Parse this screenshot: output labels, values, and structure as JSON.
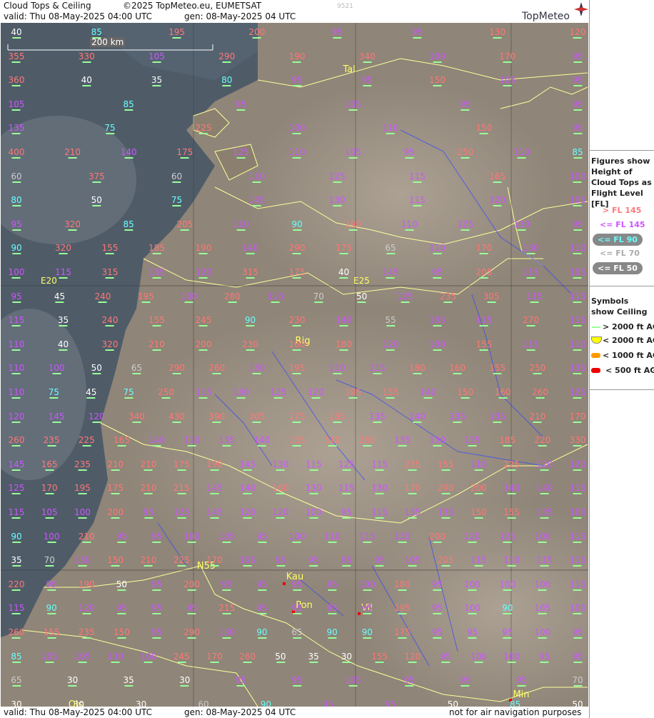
{
  "header": {
    "title": "Cloud Tops & Ceiling",
    "copyright": "©2025 TopMeteo.eu, EUMETSAT",
    "valid": "valid:  Thu  08-May-2025  04:00 UTC",
    "gen": "gen: 08-May-2025 04 UTC",
    "code": "9521",
    "logo": "TopMeteo"
  },
  "footer": {
    "valid": "valid:  Thu  08-May-2025  04:00 UTC",
    "gen": "gen: 08-May-2025 04 UTC",
    "disclaimer": "not for air navigation purposes"
  },
  "scale_label": "200 km",
  "legend": {
    "title": "Figures show Height of Cloud Tops as Flight Level  [FL]",
    "items": [
      "> FL 145",
      "<= FL 145",
      "<= FL 90",
      "<= FL 70",
      "<= FL 50"
    ],
    "colors": [
      "#ff7777",
      "#cc55ff",
      "#66ffff",
      "#cccccc",
      "#ffffff"
    ],
    "symbols_title": "Symbols show Ceiling",
    "symbols": [
      "> 2000 ft AGL",
      "< 2000 ft AGL",
      "< 1000 ft AGL",
      "< 500 ft AGL"
    ],
    "symbol_colors": [
      "#99ff99",
      "#ffff00",
      "#ff9900",
      "#ee0000"
    ]
  },
  "meridian_labels": [
    "E20",
    "E25"
  ],
  "cities": [
    "Tal",
    "Rig",
    "Kau",
    "Pon",
    "Vil",
    "Min",
    "Ols",
    "N55"
  ],
  "values": [
    [
      [
        "40",
        "w"
      ],
      [
        "85",
        "c"
      ],
      [
        "195",
        "p"
      ],
      [
        "200",
        "p"
      ],
      [
        "95",
        "m"
      ],
      [
        "95",
        "m"
      ],
      [
        "130",
        "p"
      ],
      [
        "120",
        "p"
      ]
    ],
    [
      [
        "355",
        "p"
      ],
      [
        "330",
        "p"
      ],
      [
        "105",
        "m"
      ],
      [
        "290",
        "p"
      ],
      [
        "190",
        "p"
      ],
      [
        "340",
        "p"
      ],
      [
        "100",
        "m"
      ],
      [
        "170",
        "p"
      ],
      [
        "95",
        "m"
      ]
    ],
    [
      [
        "360",
        "p"
      ],
      [
        "40",
        "w"
      ],
      [
        "35",
        "w"
      ],
      [
        "80",
        "c"
      ],
      [
        "95",
        "m"
      ],
      [
        "95",
        "m"
      ],
      [
        "150",
        "p"
      ],
      [
        "105",
        "m"
      ],
      [
        "95",
        "m"
      ]
    ],
    [
      [
        "105",
        "m"
      ],
      [
        "85",
        "c"
      ],
      [
        "95",
        "m"
      ],
      [
        "105",
        "m"
      ],
      [
        "95",
        "m"
      ],
      [
        "95",
        "m"
      ]
    ],
    [
      [
        "135",
        "m"
      ],
      [
        "75",
        "c"
      ],
      [
        "225",
        "p"
      ],
      [
        "100",
        "m"
      ],
      [
        "110",
        "m"
      ],
      [
        "150",
        "p"
      ],
      [
        "95",
        "m"
      ]
    ],
    [
      [
        "400",
        "p"
      ],
      [
        "210",
        "p"
      ],
      [
        "140",
        "m"
      ],
      [
        "175",
        "p"
      ],
      [
        "125",
        "m"
      ],
      [
        "110",
        "m"
      ],
      [
        "105",
        "m"
      ],
      [
        "95",
        "m"
      ],
      [
        "250",
        "p"
      ],
      [
        "110",
        "m"
      ],
      [
        "85",
        "c"
      ]
    ],
    [
      [
        "60",
        "g"
      ],
      [
        "375",
        "p"
      ],
      [
        "60",
        "g"
      ],
      [
        "110",
        "m"
      ],
      [
        "125",
        "m"
      ],
      [
        "115",
        "m"
      ],
      [
        "165",
        "p"
      ],
      [
        "100",
        "m"
      ]
    ],
    [
      [
        "80",
        "c"
      ],
      [
        "50",
        "w"
      ],
      [
        "75",
        "c"
      ],
      [
        "145",
        "m"
      ],
      [
        "130",
        "m"
      ],
      [
        "115",
        "m"
      ],
      [
        "120",
        "m"
      ],
      [
        "105",
        "m"
      ]
    ],
    [
      [
        "95",
        "m"
      ],
      [
        "320",
        "p"
      ],
      [
        "85",
        "c"
      ],
      [
        "205",
        "p"
      ],
      [
        "110",
        "m"
      ],
      [
        "90",
        "c"
      ],
      [
        "190",
        "p"
      ],
      [
        "110",
        "m"
      ],
      [
        "125",
        "m"
      ],
      [
        "130",
        "m"
      ],
      [
        "95",
        "m"
      ]
    ],
    [
      [
        "90",
        "c"
      ],
      [
        "320",
        "p"
      ],
      [
        "155",
        "p"
      ],
      [
        "185",
        "p"
      ],
      [
        "190",
        "p"
      ],
      [
        "140",
        "m"
      ],
      [
        "290",
        "p"
      ],
      [
        "175",
        "p"
      ],
      [
        "65",
        "g"
      ],
      [
        "110",
        "m"
      ],
      [
        "170",
        "p"
      ],
      [
        "130",
        "m"
      ],
      [
        "110",
        "m"
      ]
    ],
    [
      [
        "100",
        "m"
      ],
      [
        "115",
        "m"
      ],
      [
        "315",
        "p"
      ],
      [
        "135",
        "m"
      ],
      [
        "120",
        "m"
      ],
      [
        "315",
        "p"
      ],
      [
        "175",
        "p"
      ],
      [
        "40",
        "w"
      ],
      [
        "145",
        "m"
      ],
      [
        "95",
        "m"
      ],
      [
        "205",
        "p"
      ],
      [
        "115",
        "m"
      ],
      [
        "105",
        "m"
      ]
    ],
    [
      [
        "95",
        "m"
      ],
      [
        "45",
        "w"
      ],
      [
        "240",
        "p"
      ],
      [
        "195",
        "p"
      ],
      [
        "100",
        "m"
      ],
      [
        "280",
        "p"
      ],
      [
        "110",
        "m"
      ],
      [
        "70",
        "g"
      ],
      [
        "50",
        "w"
      ],
      [
        "125",
        "m"
      ],
      [
        "235",
        "p"
      ],
      [
        "305",
        "p"
      ],
      [
        "115",
        "m"
      ],
      [
        "115",
        "m"
      ]
    ],
    [
      [
        "115",
        "m"
      ],
      [
        "35",
        "w"
      ],
      [
        "240",
        "p"
      ],
      [
        "155",
        "p"
      ],
      [
        "245",
        "p"
      ],
      [
        "90",
        "c"
      ],
      [
        "230",
        "p"
      ],
      [
        "140",
        "m"
      ],
      [
        "55",
        "g"
      ],
      [
        "135",
        "m"
      ],
      [
        "115",
        "m"
      ],
      [
        "270",
        "p"
      ],
      [
        "115",
        "m"
      ]
    ],
    [
      [
        "110",
        "m"
      ],
      [
        "40",
        "w"
      ],
      [
        "320",
        "p"
      ],
      [
        "210",
        "p"
      ],
      [
        "200",
        "p"
      ],
      [
        "230",
        "p"
      ],
      [
        "160",
        "p"
      ],
      [
        "180",
        "p"
      ],
      [
        "120",
        "m"
      ],
      [
        "130",
        "m"
      ],
      [
        "155",
        "p"
      ],
      [
        "115",
        "m"
      ],
      [
        "110",
        "m"
      ]
    ],
    [
      [
        "110",
        "m"
      ],
      [
        "100",
        "m"
      ],
      [
        "50",
        "w"
      ],
      [
        "65",
        "g"
      ],
      [
        "290",
        "p"
      ],
      [
        "260",
        "p"
      ],
      [
        "130",
        "m"
      ],
      [
        "195",
        "p"
      ],
      [
        "110",
        "m"
      ],
      [
        "115",
        "m"
      ],
      [
        "180",
        "p"
      ],
      [
        "160",
        "p"
      ],
      [
        "155",
        "p"
      ],
      [
        "250",
        "p"
      ],
      [
        "135",
        "m"
      ]
    ],
    [
      [
        "110",
        "m"
      ],
      [
        "75",
        "c"
      ],
      [
        "45",
        "w"
      ],
      [
        "75",
        "c"
      ],
      [
        "250",
        "p"
      ],
      [
        "115",
        "m"
      ],
      [
        "130",
        "m"
      ],
      [
        "125",
        "m"
      ],
      [
        "120",
        "m"
      ],
      [
        "195",
        "p"
      ],
      [
        "155",
        "p"
      ],
      [
        "140",
        "m"
      ],
      [
        "150",
        "p"
      ],
      [
        "160",
        "p"
      ],
      [
        "260",
        "p"
      ],
      [
        "125",
        "m"
      ]
    ],
    [
      [
        "120",
        "m"
      ],
      [
        "145",
        "m"
      ],
      [
        "120",
        "m"
      ],
      [
        "340",
        "p"
      ],
      [
        "430",
        "p"
      ],
      [
        "390",
        "p"
      ],
      [
        "305",
        "p"
      ],
      [
        "175",
        "p"
      ],
      [
        "165",
        "p"
      ],
      [
        "135",
        "m"
      ],
      [
        "140",
        "m"
      ],
      [
        "135",
        "m"
      ],
      [
        "135",
        "m"
      ],
      [
        "210",
        "p"
      ],
      [
        "170",
        "p"
      ]
    ],
    [
      [
        "260",
        "p"
      ],
      [
        "235",
        "p"
      ],
      [
        "225",
        "p"
      ],
      [
        "165",
        "p"
      ],
      [
        "140",
        "m"
      ],
      [
        "110",
        "m"
      ],
      [
        "135",
        "m"
      ],
      [
        "140",
        "m"
      ],
      [
        "155",
        "p"
      ],
      [
        "310",
        "p"
      ],
      [
        "265",
        "p"
      ],
      [
        "135",
        "m"
      ],
      [
        "130",
        "m"
      ],
      [
        "135",
        "m"
      ],
      [
        "185",
        "p"
      ],
      [
        "220",
        "p"
      ],
      [
        "330",
        "p"
      ]
    ],
    [
      [
        "145",
        "m"
      ],
      [
        "165",
        "p"
      ],
      [
        "235",
        "p"
      ],
      [
        "210",
        "p"
      ],
      [
        "210",
        "p"
      ],
      [
        "175",
        "p"
      ],
      [
        "190",
        "p"
      ],
      [
        "145",
        "m"
      ],
      [
        "130",
        "m"
      ],
      [
        "115",
        "m"
      ],
      [
        "125",
        "m"
      ],
      [
        "115",
        "m"
      ],
      [
        "235",
        "p"
      ],
      [
        "155",
        "p"
      ],
      [
        "110",
        "m"
      ],
      [
        "225",
        "p"
      ],
      [
        "120",
        "m"
      ],
      [
        "120",
        "m"
      ]
    ],
    [
      [
        "125",
        "m"
      ],
      [
        "170",
        "p"
      ],
      [
        "195",
        "p"
      ],
      [
        "175",
        "p"
      ],
      [
        "210",
        "p"
      ],
      [
        "215",
        "p"
      ],
      [
        "145",
        "m"
      ],
      [
        "140",
        "m"
      ],
      [
        "160",
        "p"
      ],
      [
        "130",
        "m"
      ],
      [
        "115",
        "m"
      ],
      [
        "130",
        "m"
      ],
      [
        "170",
        "p"
      ],
      [
        "290",
        "p"
      ],
      [
        "200",
        "p"
      ],
      [
        "140",
        "m"
      ],
      [
        "140",
        "m"
      ],
      [
        "115",
        "m"
      ]
    ],
    [
      [
        "115",
        "m"
      ],
      [
        "105",
        "m"
      ],
      [
        "100",
        "m"
      ],
      [
        "200",
        "p"
      ],
      [
        "95",
        "m"
      ],
      [
        "125",
        "m"
      ],
      [
        "145",
        "m"
      ],
      [
        "120",
        "m"
      ],
      [
        "120",
        "m"
      ],
      [
        "100",
        "m"
      ],
      [
        "95",
        "m"
      ],
      [
        "115",
        "m"
      ],
      [
        "135",
        "m"
      ],
      [
        "135",
        "m"
      ],
      [
        "150",
        "p"
      ],
      [
        "155",
        "p"
      ],
      [
        "135",
        "m"
      ],
      [
        "100",
        "m"
      ]
    ],
    [
      [
        "90",
        "c"
      ],
      [
        "100",
        "m"
      ],
      [
        "210",
        "p"
      ],
      [
        "95",
        "m"
      ],
      [
        "95",
        "m"
      ],
      [
        "100",
        "m"
      ],
      [
        "105",
        "m"
      ],
      [
        "95",
        "m"
      ],
      [
        "100",
        "m"
      ],
      [
        "110",
        "m"
      ],
      [
        "115",
        "m"
      ],
      [
        "130",
        "m"
      ],
      [
        "200",
        "p"
      ],
      [
        "120",
        "m"
      ],
      [
        "125",
        "m"
      ],
      [
        "100",
        "m"
      ],
      [
        "115",
        "m"
      ]
    ],
    [
      [
        "35",
        "w"
      ],
      [
        "70",
        "g"
      ],
      [
        "130",
        "m"
      ],
      [
        "150",
        "p"
      ],
      [
        "210",
        "p"
      ],
      [
        "225",
        "p"
      ],
      [
        "170",
        "p"
      ],
      [
        "105",
        "m"
      ],
      [
        "95",
        "m"
      ],
      [
        "95",
        "m"
      ],
      [
        "95",
        "m"
      ],
      [
        "95",
        "m"
      ],
      [
        "105",
        "m"
      ],
      [
        "205",
        "p"
      ],
      [
        "115",
        "m"
      ],
      [
        "110",
        "m"
      ],
      [
        "115",
        "m"
      ],
      [
        "115",
        "m"
      ]
    ],
    [
      [
        "220",
        "p"
      ],
      [
        "95",
        "m"
      ],
      [
        "190",
        "p"
      ],
      [
        "50",
        "w"
      ],
      [
        "95",
        "m"
      ],
      [
        "200",
        "p"
      ],
      [
        "95",
        "m"
      ],
      [
        "95",
        "m"
      ],
      [
        "95",
        "m"
      ],
      [
        "95",
        "m"
      ],
      [
        "100",
        "m"
      ],
      [
        "180",
        "p"
      ],
      [
        "95",
        "m"
      ],
      [
        "100",
        "m"
      ],
      [
        "100",
        "m"
      ],
      [
        "100",
        "m"
      ],
      [
        "115",
        "m"
      ]
    ],
    [
      [
        "115",
        "m"
      ],
      [
        "90",
        "c"
      ],
      [
        "120",
        "m"
      ],
      [
        "95",
        "m"
      ],
      [
        "95",
        "m"
      ],
      [
        "95",
        "m"
      ],
      [
        "215",
        "p"
      ],
      [
        "95",
        "m"
      ],
      [
        "95",
        "m"
      ],
      [
        "95",
        "m"
      ],
      [
        "95",
        "m"
      ],
      [
        "195",
        "p"
      ],
      [
        "95",
        "m"
      ],
      [
        "100",
        "m"
      ],
      [
        "90",
        "c"
      ],
      [
        "105",
        "m"
      ],
      [
        "100",
        "m"
      ]
    ],
    [
      [
        "260",
        "p"
      ],
      [
        "155",
        "p"
      ],
      [
        "235",
        "p"
      ],
      [
        "150",
        "p"
      ],
      [
        "95",
        "m"
      ],
      [
        "290",
        "p"
      ],
      [
        "130",
        "m"
      ],
      [
        "90",
        "c"
      ],
      [
        "65",
        "g"
      ],
      [
        "90",
        "c"
      ],
      [
        "90",
        "c"
      ],
      [
        "175",
        "p"
      ],
      [
        "95",
        "m"
      ],
      [
        "95",
        "m"
      ],
      [
        "95",
        "m"
      ],
      [
        "100",
        "m"
      ],
      [
        "95",
        "m"
      ]
    ],
    [
      [
        "85",
        "c"
      ],
      [
        "105",
        "m"
      ],
      [
        "105",
        "m"
      ],
      [
        "130",
        "m"
      ],
      [
        "100",
        "m"
      ],
      [
        "245",
        "p"
      ],
      [
        "170",
        "p"
      ],
      [
        "260",
        "p"
      ],
      [
        "50",
        "w"
      ],
      [
        "35",
        "w"
      ],
      [
        "30",
        "w"
      ],
      [
        "155",
        "p"
      ],
      [
        "120",
        "p"
      ],
      [
        "95",
        "m"
      ],
      [
        "100",
        "m"
      ],
      [
        "100",
        "m"
      ],
      [
        "95",
        "m"
      ],
      [
        "95",
        "m"
      ]
    ],
    [
      [
        "65",
        "g"
      ],
      [
        "30",
        "w"
      ],
      [
        "35",
        "w"
      ],
      [
        "30",
        "w"
      ],
      [
        "95",
        "m"
      ],
      [
        "95",
        "m"
      ],
      [
        "105",
        "m"
      ],
      [
        "95",
        "m"
      ],
      [
        "95",
        "m"
      ],
      [
        "95",
        "m"
      ],
      [
        "70",
        "g"
      ]
    ],
    [
      [
        "30",
        "w"
      ],
      [
        "30",
        "w"
      ],
      [
        "30",
        "w"
      ],
      [
        "60",
        "g"
      ],
      [
        "90",
        "c"
      ],
      [
        "95",
        "m"
      ],
      [
        "95",
        "m"
      ],
      [
        "50",
        "w"
      ],
      [
        "85",
        "c"
      ],
      [
        "50",
        "w"
      ]
    ]
  ]
}
